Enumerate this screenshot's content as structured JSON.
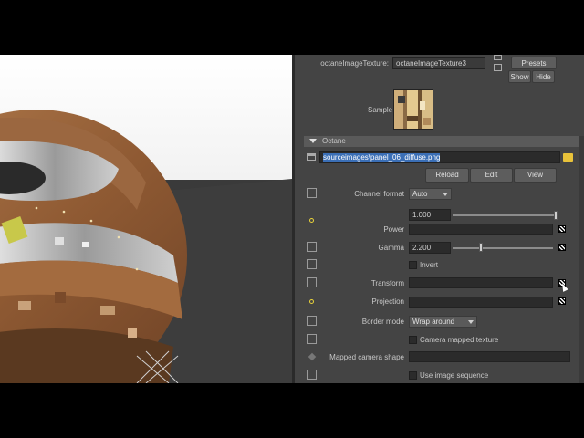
{
  "header": {
    "texture_label": "octaneImageTexture:",
    "texture_value": "octaneImageTexture3",
    "presets_label": "Presets",
    "show_label": "Show",
    "hide_label": "Hide",
    "sample_label": "Sample"
  },
  "octane_section": {
    "title": "Octane",
    "file_path": "sourceimages\\panel_06_diffuse.png",
    "reload_label": "Reload",
    "edit_label": "Edit",
    "view_label": "View",
    "channel_format_label": "Channel format",
    "channel_format_value": "Auto",
    "power_value": "1.000",
    "power_slider_fraction": 0.97,
    "power_label": "Power",
    "gamma_label": "Gamma",
    "gamma_value": "2.200",
    "gamma_slider_fraction": 0.28,
    "invert_label": "Invert",
    "transform_label": "Transform",
    "projection_label": "Projection",
    "border_mode_label": "Border mode",
    "border_mode_value": "Wrap around",
    "camera_mapped_label": "Camera mapped texture",
    "mapped_camera_shape_label": "Mapped camera shape",
    "use_image_sequence_label": "Use image sequence"
  },
  "colors": {
    "panel_bg": "#444444",
    "field_bg": "#2b2b2b",
    "selection": "#3b6fb6",
    "icon_yellow": "#e8d23a"
  }
}
